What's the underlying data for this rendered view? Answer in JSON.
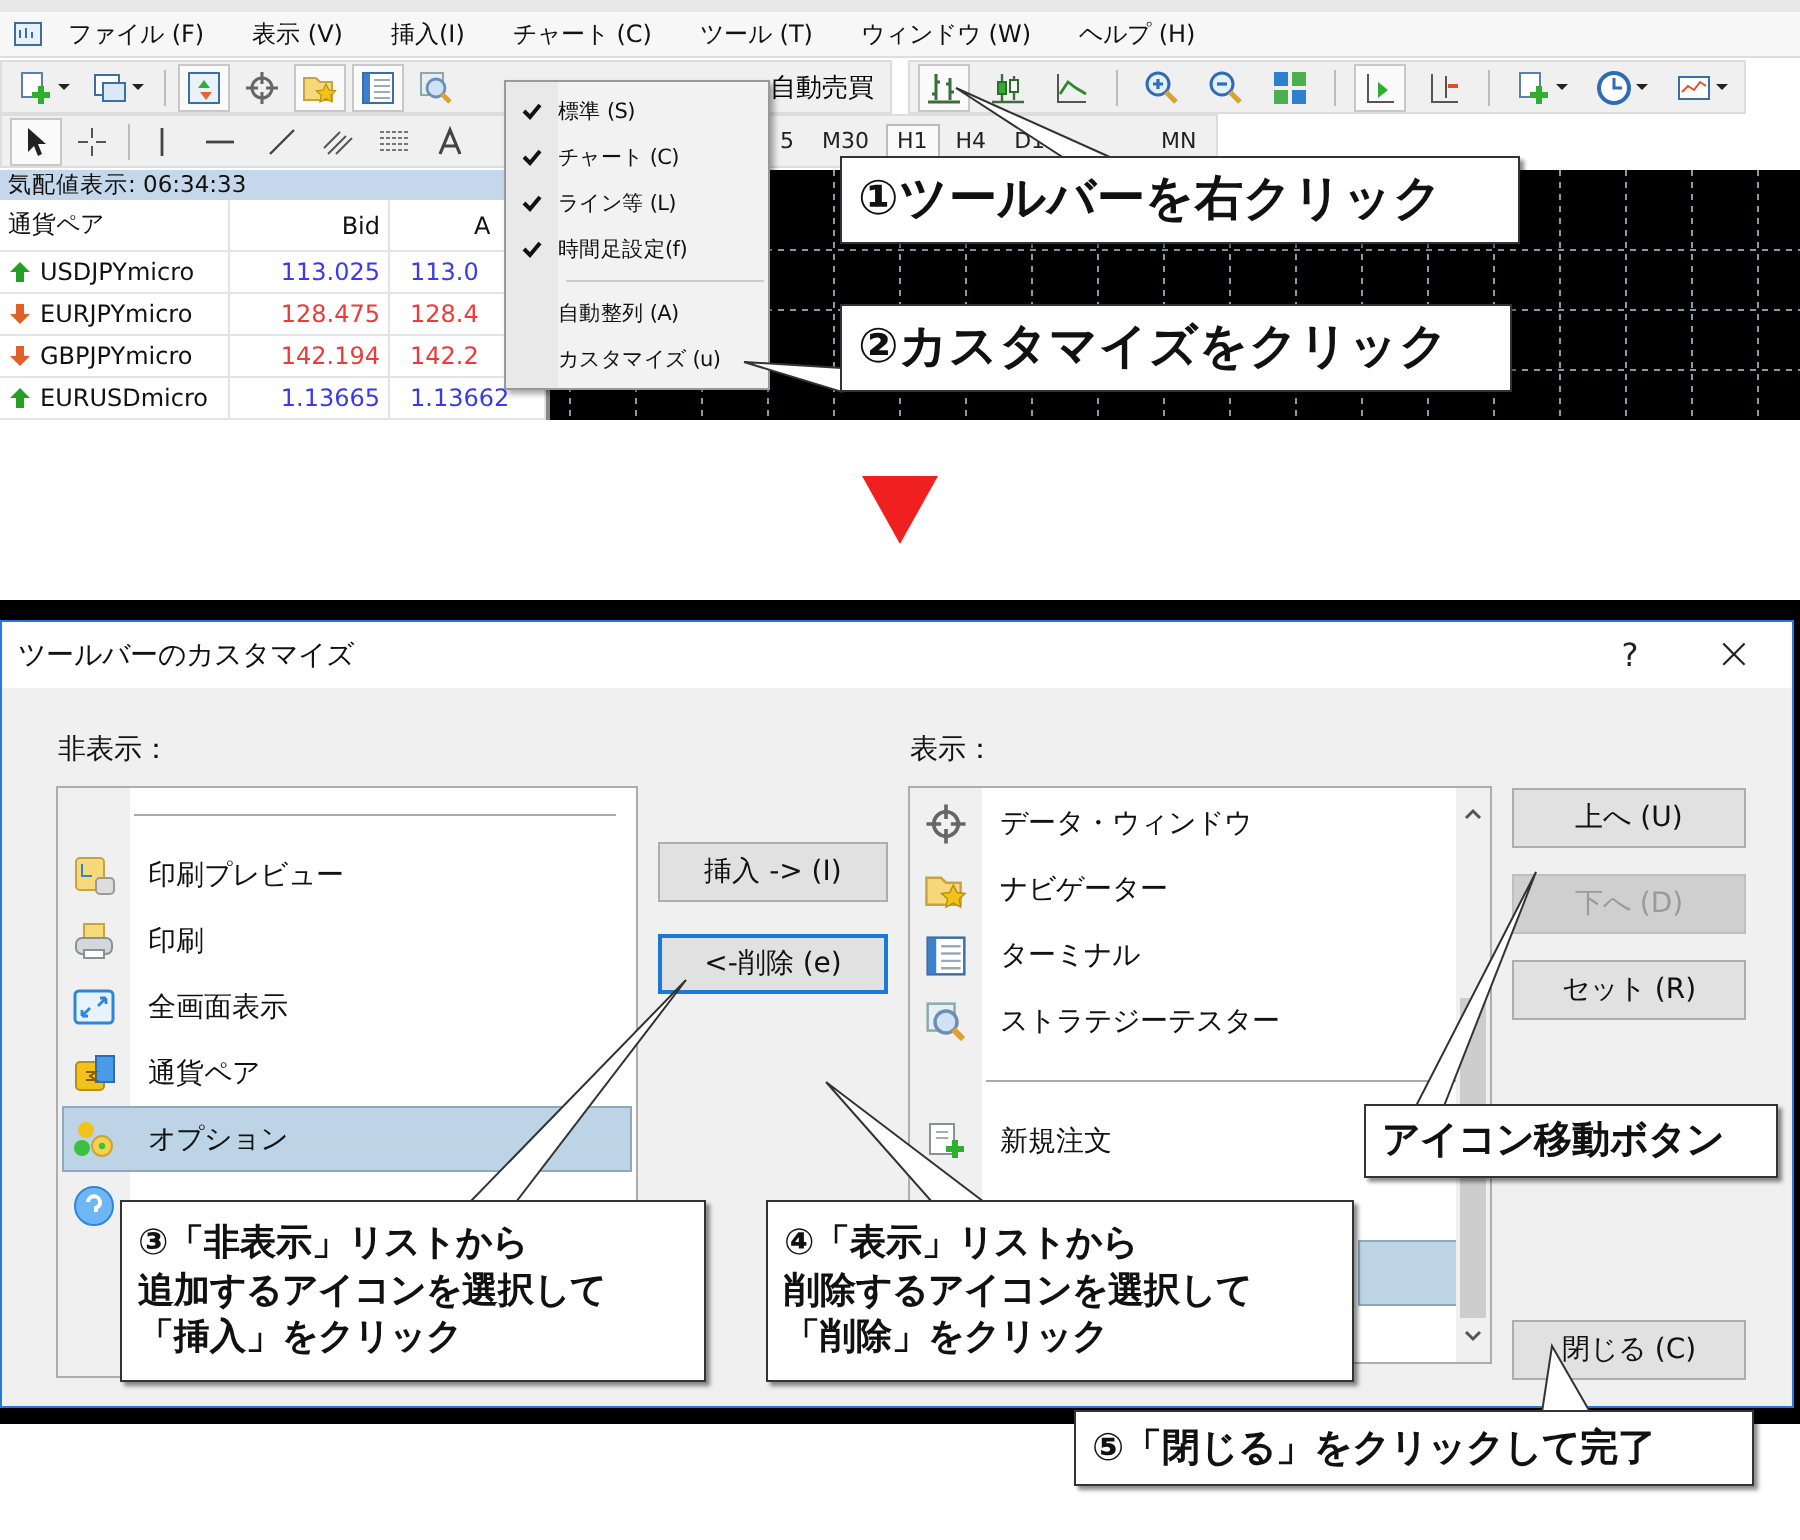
{
  "menu_bar": {
    "items": [
      "ファイル (F)",
      "表示 (V)",
      "挿入(I)",
      "チャート (C)",
      "ツール (T)",
      "ウィンドウ (W)",
      "ヘルプ (H)"
    ]
  },
  "toolbar": {
    "autotrade_button": "自動売買"
  },
  "timeframes": [
    {
      "label": "5",
      "selected": false
    },
    {
      "label": "M30",
      "selected": false
    },
    {
      "label": "H1",
      "selected": true
    },
    {
      "label": "H4",
      "selected": false
    },
    {
      "label": "D1",
      "selected": false
    },
    {
      "label": "MN",
      "selected": false
    }
  ],
  "market_watch": {
    "title": "気配値表示: 06:34:33",
    "columns": [
      "通貨ペア",
      "Bid",
      "A"
    ],
    "rows": [
      {
        "symbol": "USDJPYmicro",
        "rising": true,
        "bid": "113.025",
        "ask": "113.0"
      },
      {
        "symbol": "EURJPYmicro",
        "rising": false,
        "bid": "128.475",
        "ask": "128.4"
      },
      {
        "symbol": "GBPJPYmicro",
        "rising": false,
        "bid": "142.194",
        "ask": "142.2"
      },
      {
        "symbol": "EURUSDmicro",
        "rising": true,
        "bid": "1.13665",
        "ask": "1.13662"
      }
    ]
  },
  "context_menu": {
    "groups": [
      [
        {
          "label": "標準 (S)",
          "checked": true
        },
        {
          "label": "チャート (C)",
          "checked": true
        },
        {
          "label": "ライン等 (L)",
          "checked": true
        },
        {
          "label": "時間足設定(f)",
          "checked": true
        }
      ],
      [
        {
          "label": "自動整列 (A)",
          "checked": false
        },
        {
          "label": "カスタマイズ (u)",
          "checked": false
        }
      ]
    ]
  },
  "dialog": {
    "title": "ツールバーのカスタマイズ",
    "help_button": "?",
    "close_button": "×",
    "hidden_label": "非表示：",
    "hidden_items": [
      {
        "kind": "separator"
      },
      {
        "kind": "item",
        "label": "印刷プレビュー",
        "selected": false
      },
      {
        "kind": "item",
        "label": "印刷",
        "selected": false
      },
      {
        "kind": "item",
        "label": "全画面表示",
        "selected": false
      },
      {
        "kind": "item",
        "label": "通貨ペア",
        "selected": false
      },
      {
        "kind": "item",
        "label": "オプション",
        "selected": true
      },
      {
        "kind": "item",
        "selected": false
      }
    ],
    "insert_button": {
      "label": "挿入 -> (I)",
      "focused": false
    },
    "remove_button": {
      "label": "<-削除 (e)",
      "focused": true
    },
    "shown_label": "表示：",
    "shown_items": [
      {
        "kind": "item",
        "label": "データ・ウィンドウ",
        "selected": false
      },
      {
        "kind": "item",
        "label": "ナビゲーター",
        "selected": false
      },
      {
        "kind": "item",
        "label": "ターミナル",
        "selected": false
      },
      {
        "kind": "item",
        "label": "ストラテジーテスター",
        "selected": false
      },
      {
        "kind": "separator"
      },
      {
        "kind": "item",
        "label": "新規注文",
        "selected": false
      },
      {
        "kind": "item",
        "selected": false
      },
      {
        "kind": "item",
        "selected": true
      }
    ],
    "side_buttons": [
      {
        "label": "上へ (U)",
        "disabled": false
      },
      {
        "label": "下へ (D)",
        "disabled": true
      },
      {
        "label": "セット (R)",
        "disabled": false
      }
    ],
    "close_dialog_button": {
      "label": "閉じる (C)",
      "disabled": false
    }
  },
  "callouts": [
    {
      "lines": [
        "①ツールバーを右クリック"
      ]
    },
    {
      "lines": [
        "②カスタマイズをクリック"
      ]
    },
    {
      "lines": [
        "③「非表示」リストから",
        "追加するアイコンを選択して",
        "「挿入」をクリック"
      ]
    },
    {
      "lines": [
        "④「表示」リストから",
        "削除するアイコンを選択して",
        "「削除」をクリック"
      ]
    },
    {
      "lines": [
        "アイコン移動ボタン"
      ]
    },
    {
      "lines": [
        "⑤「閉じる」をクリックして完了"
      ]
    }
  ]
}
